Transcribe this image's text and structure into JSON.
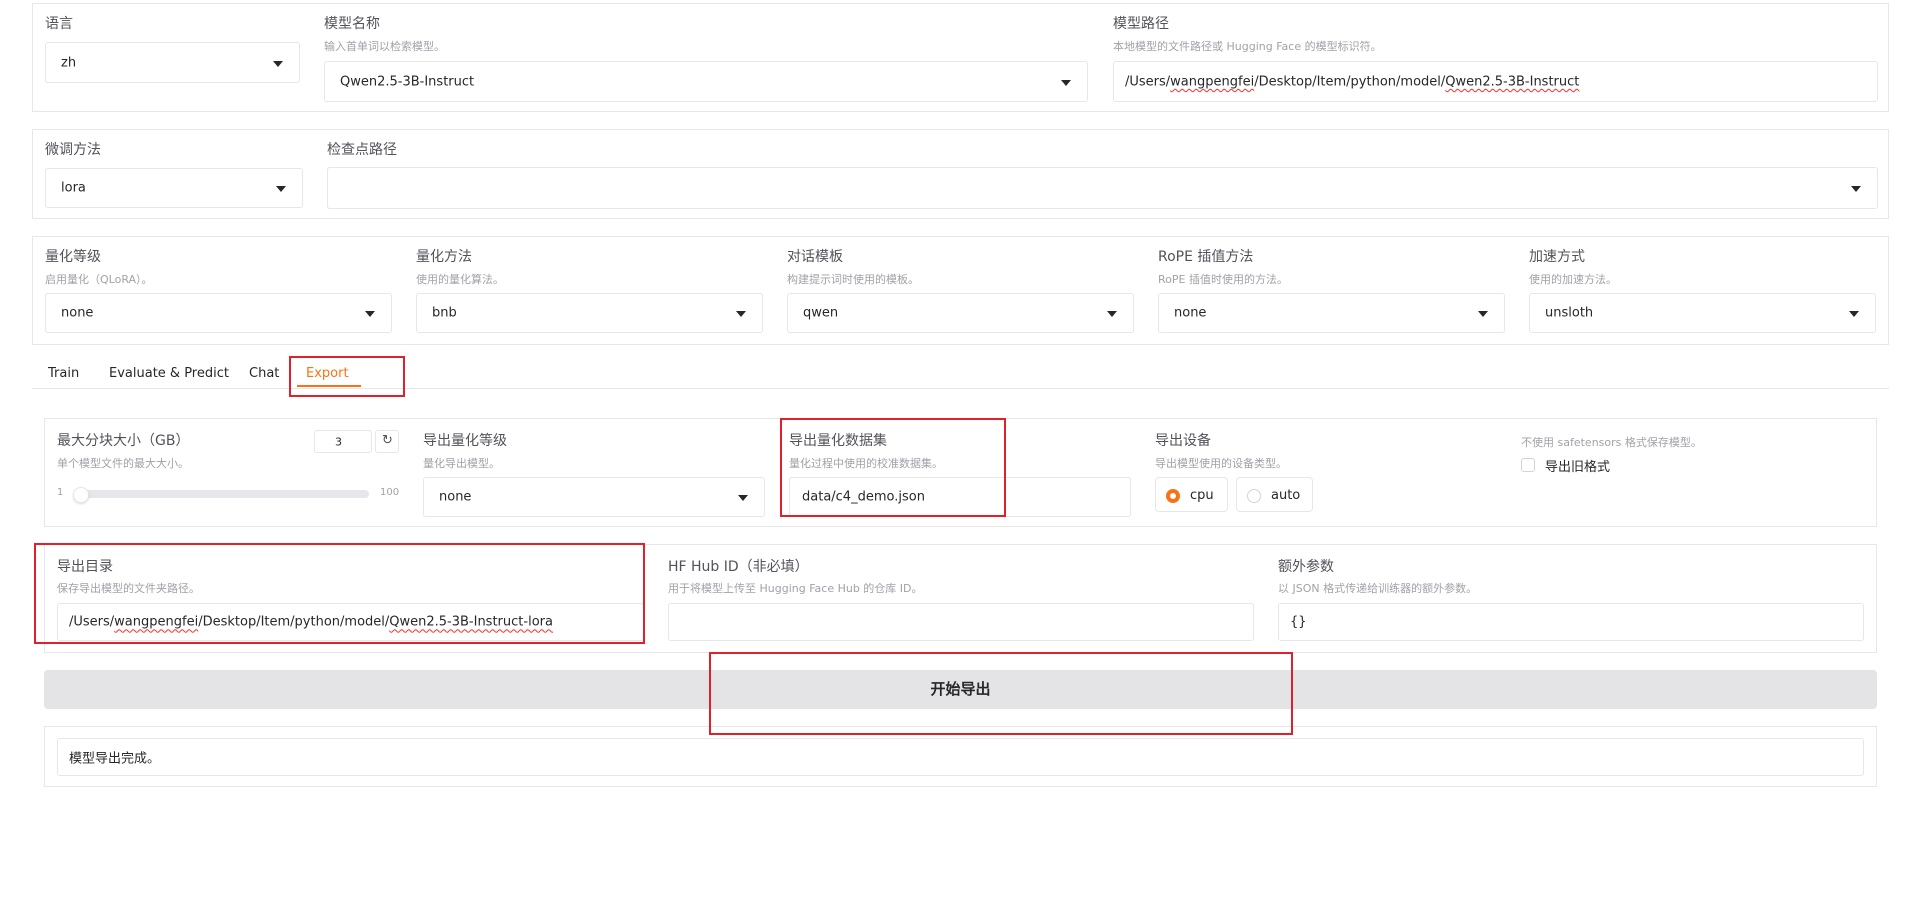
{
  "top": {
    "language": {
      "label": "语言",
      "value": "zh"
    },
    "model_name": {
      "label": "模型名称",
      "info": "输入首单词以检索模型。",
      "value": "Qwen2.5-3B-Instruct"
    },
    "model_path": {
      "label": "模型路径",
      "info": "本地模型的文件路径或 Hugging Face 的模型标识符。",
      "value_prefix": "/Users/",
      "value_user": "wangpengfei",
      "value_mid": "/Desktop/Item/python/model/",
      "value_model": "Qwen2.5-3B-Instruct"
    }
  },
  "finetune": {
    "method": {
      "label": "微调方法",
      "value": "lora"
    },
    "checkpoint": {
      "label": "检查点路径",
      "value": ""
    }
  },
  "advanced": [
    {
      "label": "量化等级",
      "info": "启用量化（QLoRA）。",
      "value": "none"
    },
    {
      "label": "量化方法",
      "info": "使用的量化算法。",
      "value": "bnb"
    },
    {
      "label": "对话模板",
      "info": "构建提示词时使用的模板。",
      "value": "qwen"
    },
    {
      "label": "RoPE 插值方法",
      "info": "RoPE 插值时使用的方法。",
      "value": "none"
    },
    {
      "label": "加速方式",
      "info": "使用的加速方法。",
      "value": "unsloth"
    }
  ],
  "tabs": [
    "Train",
    "Evaluate & Predict",
    "Chat",
    "Export"
  ],
  "active_tab": "Export",
  "export": {
    "shard_size": {
      "label": "最大分块大小（GB）",
      "info": "单个模型文件的最大大小。",
      "value": "3",
      "min": "1",
      "max": "100",
      "fraction": 0.0
    },
    "quant_bit": {
      "label": "导出量化等级",
      "info": "量化导出模型。",
      "value": "none"
    },
    "quant_dataset": {
      "label": "导出量化数据集",
      "info": "量化过程中使用的校准数据集。",
      "value": "data/c4_demo.json"
    },
    "device": {
      "label": "导出设备",
      "info": "导出模型使用的设备类型。",
      "options": [
        "cpu",
        "auto"
      ],
      "selected": "cpu"
    },
    "legacy": {
      "info": "不使用 safetensors 格式保存模型。",
      "label": "导出旧格式",
      "checked": false
    },
    "export_dir": {
      "label": "导出目录",
      "info": "保存导出模型的文件夹路径。",
      "value_prefix": "/Users/",
      "value_user": "wangpengfei",
      "value_mid": "/Desktop/Item/python/model/",
      "value_model": "Qwen2.5-3B-Instruct-lora"
    },
    "hub_id": {
      "label": "HF Hub ID（非必填）",
      "info": "用于将模型上传至 Hugging Face Hub 的仓库 ID。",
      "value": ""
    },
    "extra_args": {
      "label": "额外参数",
      "info": "以 JSON 格式传递给训练器的额外参数。",
      "value": "{}"
    },
    "start_button": "开始导出",
    "output": "模型导出完成。"
  },
  "colors": {
    "accent": "#f97316",
    "highlight": "#e0202a",
    "border": "#e5e7eb",
    "button_bg": "#e4e4e7"
  }
}
